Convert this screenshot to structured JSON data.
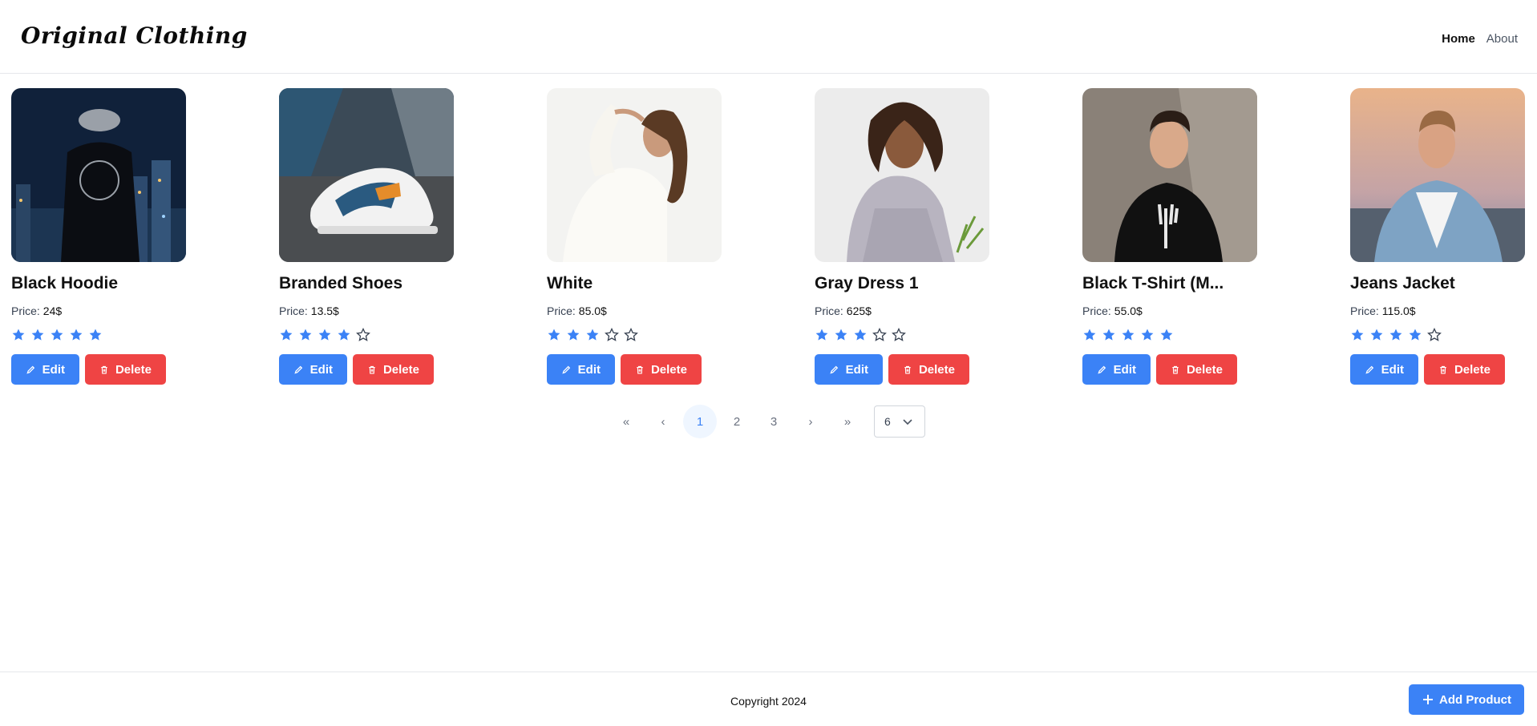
{
  "header": {
    "logo": "Original Clothing",
    "nav": {
      "home": "Home",
      "about": "About"
    }
  },
  "price_label": "Price:",
  "buttons": {
    "edit": "Edit",
    "delete": "Delete"
  },
  "products": [
    {
      "name": "Black Hoodie",
      "price": "24$",
      "rating": 5
    },
    {
      "name": "Branded Shoes",
      "price": "13.5$",
      "rating": 4
    },
    {
      "name": "White",
      "price": "85.0$",
      "rating": 3
    },
    {
      "name": "Gray Dress 1",
      "price": "625$",
      "rating": 3
    },
    {
      "name": "Black T-Shirt (M...",
      "price": "55.0$",
      "rating": 5
    },
    {
      "name": "Jeans Jacket",
      "price": "115.0$",
      "rating": 4
    }
  ],
  "pagination": {
    "first": "«",
    "prev": "‹",
    "pages": [
      "1",
      "2",
      "3"
    ],
    "current": "1",
    "next": "›",
    "last": "»",
    "page_size": "6"
  },
  "footer": {
    "copyright": "Copyright 2024",
    "add_product": "Add Product"
  },
  "colors": {
    "accent": "#3b82f6",
    "danger": "#ef4444",
    "star": "#3b82f6"
  }
}
